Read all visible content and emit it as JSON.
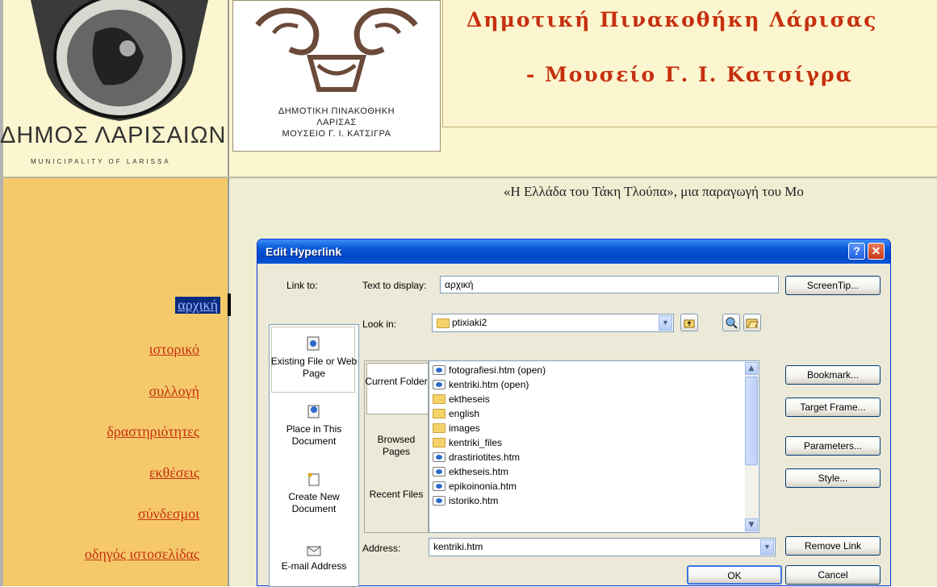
{
  "website": {
    "municipality_logo_alt": "ΔΗΜΟΣ ΛΑΡΙΣΑΙΩΝ",
    "municipality_tagline": "MUNICIPALITY OF LARISSA",
    "gallery_logo_line1": "ΔΗΜΟΤΙΚΗ ΠΙΝΑΚΟΘΗΚΗ",
    "gallery_logo_line2": "ΛΑΡΙΣΑΣ",
    "gallery_logo_line3": "ΜΟΥΣΕΙΟ Γ. Ι. ΚΑΤΣΙΓΡΑ",
    "title_line1": "Δημοτική Πινακοθήκη Λάρισας",
    "title_line2": "- Μουσείο Γ. Ι. Κατσίγρα",
    "marquee": "«Η Ελλάδα του Τάκη Τλούπα», μια παραγωγή του Μο",
    "nav": [
      {
        "label": "αρχική",
        "selected": true
      },
      {
        "label": "ιστορικό"
      },
      {
        "label": "συλλογή"
      },
      {
        "label": "δραστηριότητες"
      },
      {
        "label": "εκθέσεις"
      },
      {
        "label": "σύνδεσμοι"
      },
      {
        "label": "οδηγός ιστοσελίδας"
      }
    ]
  },
  "dialog": {
    "title": "Edit Hyperlink",
    "help_glyph": "?",
    "close_glyph": "✕",
    "link_to_label": "Link to:",
    "text_to_display_label": "Text to display:",
    "text_to_display_value": "αρχική",
    "screentip_button": "ScreenTip...",
    "look_in_label": "Look in:",
    "look_in_value": "ptixiaki2",
    "link_bar": [
      {
        "label": "Existing File or Web Page",
        "icon": "existing-file-icon"
      },
      {
        "label": "Place in This Document",
        "icon": "place-in-document-icon"
      },
      {
        "label": "Create New Document",
        "icon": "new-document-icon"
      },
      {
        "label": "E-mail Address",
        "icon": "email-icon"
      }
    ],
    "tabs": [
      {
        "label": "Current Folder"
      },
      {
        "label": "Browsed Pages"
      },
      {
        "label": "Recent Files"
      }
    ],
    "files": [
      {
        "name": "fotografiesi.htm (open)",
        "type": "htm"
      },
      {
        "name": "kentriki.htm (open)",
        "type": "htm"
      },
      {
        "name": "ektheseis",
        "type": "folder"
      },
      {
        "name": "english",
        "type": "folder"
      },
      {
        "name": "images",
        "type": "folder"
      },
      {
        "name": "kentriki_files",
        "type": "folder"
      },
      {
        "name": "drastiriotites.htm",
        "type": "htm"
      },
      {
        "name": "ektheseis.htm",
        "type": "htm"
      },
      {
        "name": "epikoinonia.htm",
        "type": "htm"
      },
      {
        "name": "istoriko.htm",
        "type": "htm"
      }
    ],
    "side_buttons": {
      "bookmark": "Bookmark...",
      "target_frame": "Target Frame...",
      "parameters": "Parameters...",
      "style": "Style..."
    },
    "address_label": "Address:",
    "address_value": "kentriki.htm",
    "remove_link_button": "Remove Link",
    "ok_button": "OK",
    "cancel_button": "Cancel"
  }
}
